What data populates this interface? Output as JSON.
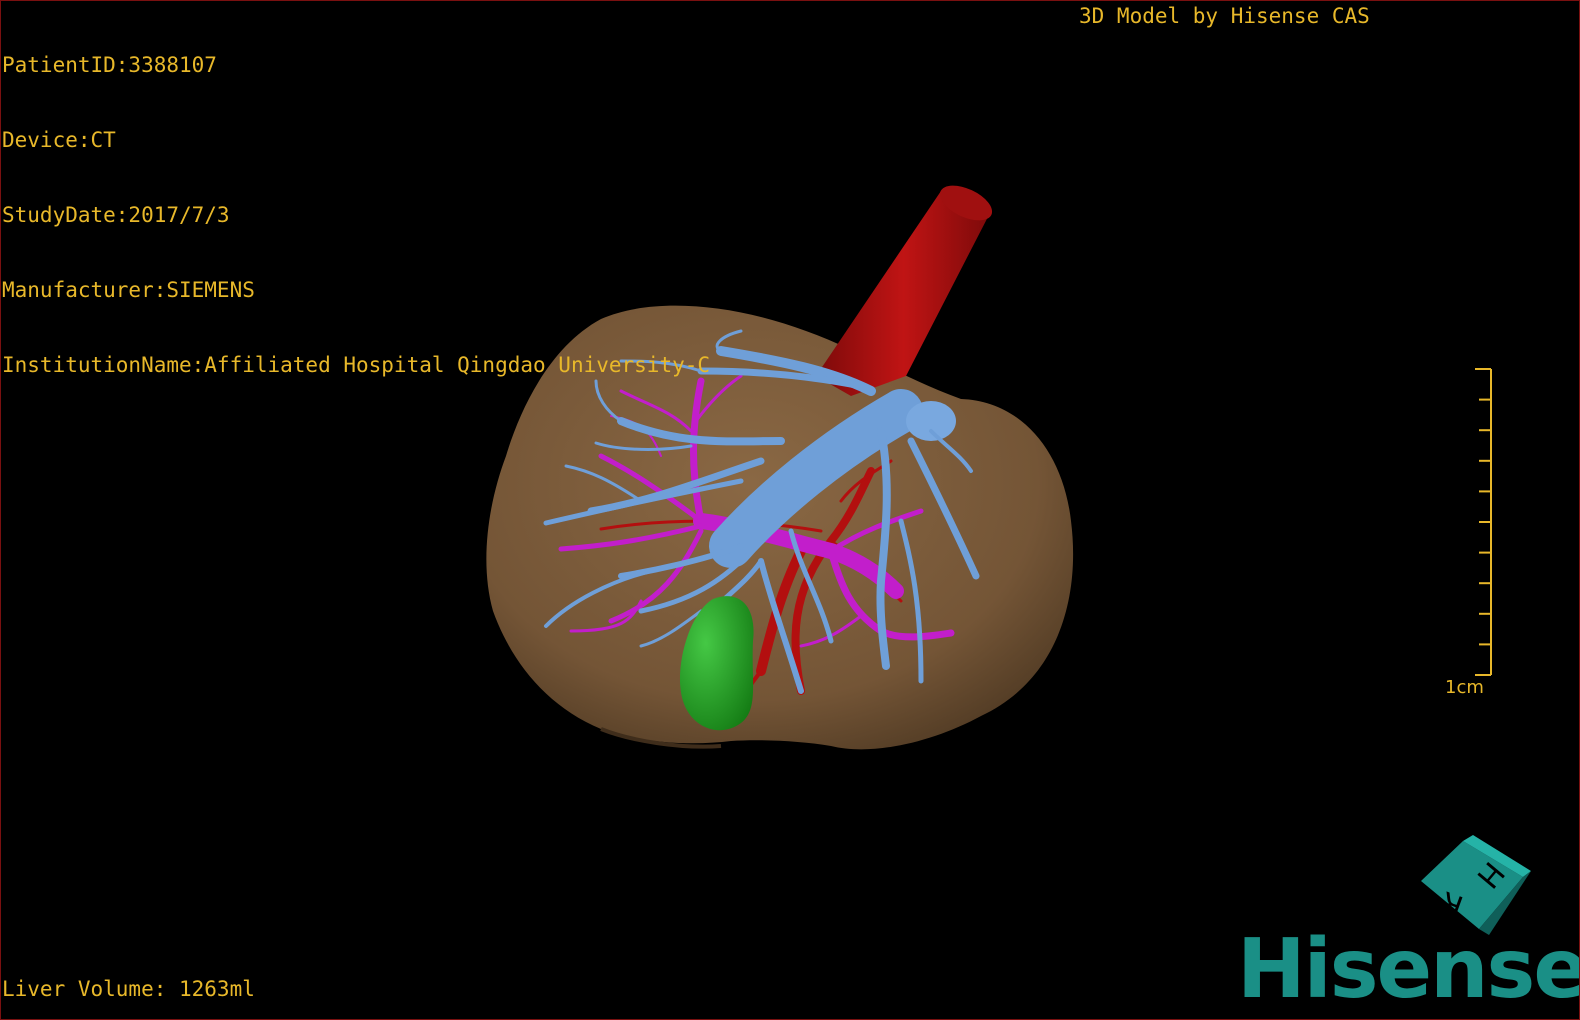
{
  "patient": {
    "id_line": "PatientID:3388107",
    "device_line": "Device:CT",
    "study_date_line": "StudyDate:2017/7/3",
    "manufacturer_line": "Manufacturer:SIEMENS",
    "institution_line": "InstitutionName:Affiliated Hospital Qingdao University-C"
  },
  "credit": "3D Model by Hisense CAS",
  "liver_volume": "Liver Volume: 1263ml",
  "scale_bar": {
    "label": "1cm",
    "ticks": 10
  },
  "brand": {
    "name": "Hisense",
    "cube_letters": [
      "H",
      "R"
    ],
    "color": "#1a8f86"
  },
  "colors": {
    "text": "#e8b82a",
    "liver": "#7d5c3a",
    "hepatic_vein": "#6f9fd8",
    "portal_vein": "#c21ecb",
    "artery": "#b30f0f",
    "gallbladder": "#1fa11f"
  }
}
